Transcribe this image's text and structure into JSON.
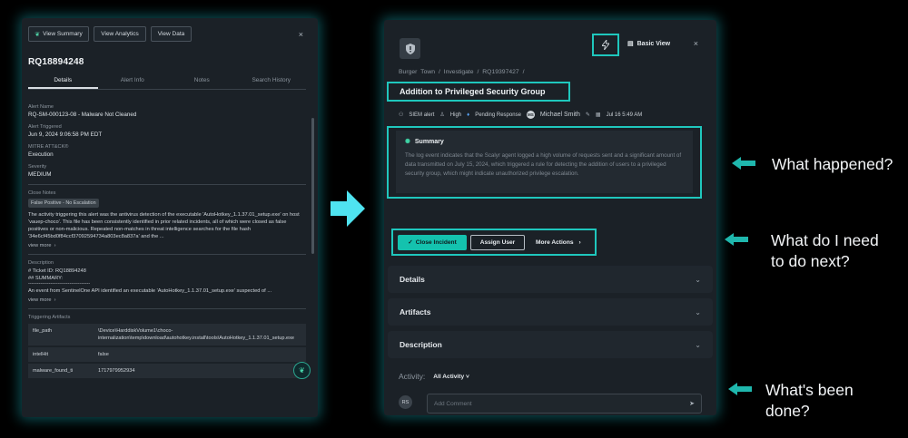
{
  "left_panel": {
    "buttons": {
      "view_summary": "View Summary",
      "view_analytics": "View Analytics",
      "view_data": "View Data"
    },
    "close": "×",
    "id": "RQ18894248",
    "tabs": [
      "Details",
      "Alert Info",
      "Notes",
      "Search History"
    ],
    "fields": {
      "alert_name_label": "Alert Name",
      "alert_name_value": "RQ-SM-000123-08 - Malware Not Cleaned",
      "alert_triggered_label": "Alert Triggered",
      "alert_triggered_value": "Jun 9, 2024 9:06:58 PM EDT",
      "mitre_label": "MITRE ATT&CK®",
      "mitre_value": "Execution",
      "severity_label": "Severity",
      "severity_value": "MEDIUM",
      "close_notes_label": "Close Notes",
      "close_notes_tag": "False Positive - No Escalation",
      "close_notes_text": "The activity triggering this alert was the antivirus detection of the executable 'AutoHotkey_1.1.37.01_setup.exe' on host 'vauep-choco'. This file has been consistently identified in prior related incidents, all of which were closed as false positives or non-malicious. Repeated non-matches in threat intelligence searches for the file hash '34e6cf45bd0f84ccf37092594734a803ec8a837a' and the ...",
      "view_more": "view more",
      "description_label": "Description",
      "description_line1": "# Ticket ID: RQ18894248",
      "description_line2": "## SUMMARY:",
      "description_line3": "------------------------------------",
      "description_line4": "An event from SentinelOne API identified an executable 'AutoHotkey_1.1.37.01_setup.exe' suspected of ...",
      "triggering_artifacts_label": "Triggering Artifacts"
    },
    "artifacts": [
      {
        "key": "file_path",
        "value": "\\Device\\HarddiskVolume1\\choco-internalization\\temp\\download\\autohotkey.install\\tools\\AutoHotkey_1.1.37.01_setup.exe"
      },
      {
        "key": "intelHit",
        "value": "false"
      },
      {
        "key": "malware_found_ti",
        "value": "1717979952934"
      }
    ]
  },
  "right_panel": {
    "bolt_icon": "⚡",
    "basic_view": "Basic View",
    "close": "×",
    "breadcrumb": [
      "Burger Town",
      "Investigate",
      "RQ19397427"
    ],
    "breadcrumb_sep": "/",
    "title": "Addition to Privileged Security Group",
    "meta": {
      "source": "SIEM alert",
      "severity": "High",
      "status": "Pending Response",
      "assignee": "Michael Smith",
      "date": "Jul 16 5:49 AM"
    },
    "summary": {
      "heading": "Summary",
      "text": "The log event indicates that the Scalyr agent logged a high volume of requests sent and a significant amount of data transmitted on July 15, 2024, which triggered a rule for detecting the addition of users to a privileged security group, which might indicate unauthorized privilege escalation."
    },
    "actions": {
      "close_incident": "Close Incident",
      "assign_user": "Assign User",
      "more_actions": "More Actions"
    },
    "sections": [
      "Details",
      "Artifacts",
      "Description"
    ],
    "activity_label": "Activity:",
    "activity_filter": "All Activity",
    "avatar_initials": "RS",
    "comment_placeholder": "Add Comment"
  },
  "callouts": {
    "what_happened": "What happened?",
    "next_line1": "What do I need",
    "next_line2": "to do next?",
    "done_line1": "What's been",
    "done_line2": "done?"
  },
  "colors": {
    "background": "#000000",
    "panel": "#1b2127",
    "accent": "#1fc7bd",
    "primary_button": "#14c2ae"
  }
}
